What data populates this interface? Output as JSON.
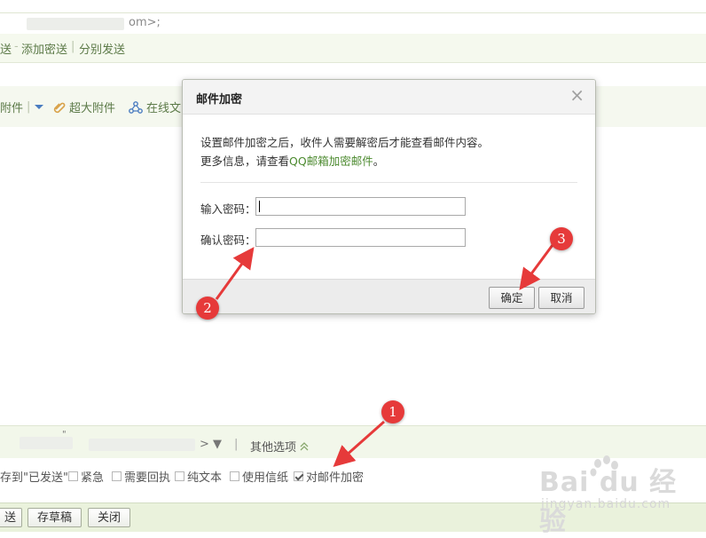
{
  "compose": {
    "to_suffix": "om>;",
    "links": {
      "send_part": "送",
      "add_bcc": "添加密送",
      "sep": "|",
      "separate_send": "分别发送"
    },
    "toolbar": {
      "attachment": "附件",
      "super_attachment": "超大附件",
      "online_doc": "在线文"
    },
    "sender": {
      "quote_mark": "\"",
      "arrow": "> ▼",
      "sep": "|",
      "other_options": "其他选项"
    },
    "options": {
      "save_sent": "存到\"已发送\"",
      "urgent": "紧急",
      "read_receipt": "需要回执",
      "plain_text": "纯文本",
      "stationery": "使用信纸",
      "encrypt": "对邮件加密"
    },
    "bottom_buttons": {
      "send": "送",
      "save_draft": "存草稿",
      "close": "关闭"
    }
  },
  "dialog": {
    "title": "邮件加密",
    "close_glyph": "×",
    "message_line1": "设置邮件加密之后，收件人需要解密后才能查看邮件内容。",
    "message_line2_prefix": "更多信息，请查看",
    "message_link": "QQ邮箱加密邮件",
    "message_line2_suffix": "。",
    "password_label": "输入密码：",
    "confirm_label": "确认密码：",
    "ok_button": "确定",
    "cancel_button": "取消"
  },
  "annotations": {
    "step1": "1",
    "step2": "2",
    "step3": "3",
    "color": "#e63a3a"
  },
  "watermark": {
    "main": "Bai du 经验",
    "sub": "jingyan.baidu.com"
  }
}
